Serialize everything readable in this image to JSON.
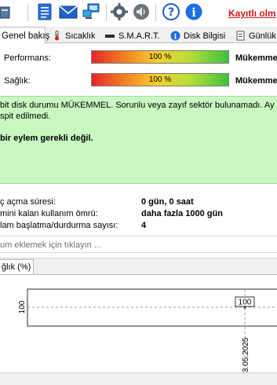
{
  "toolbar": {
    "icons": [
      "notepad-icon",
      "email-icon",
      "network-icon",
      "gear-icon",
      "speaker-icon",
      "help-icon",
      "info-icon"
    ],
    "link": "Kayıtlı olm"
  },
  "tabs": [
    {
      "label": "Genel bakış",
      "active": true
    },
    {
      "label": "Sıcaklık",
      "active": false
    },
    {
      "label": "S.M.A.R.T.",
      "active": false
    },
    {
      "label": "Disk Bilgisi",
      "active": false
    },
    {
      "label": "Günlük",
      "active": false
    }
  ],
  "health": {
    "performance": {
      "label": "Performans:",
      "value_text": "100 %",
      "value": 100,
      "status": "Mükemme"
    },
    "health": {
      "label": "Sağlık:",
      "value_text": "100 %",
      "value": 100,
      "status": "Mükemme"
    }
  },
  "message": {
    "line1": "bit disk durumu MÜKEMMEL. Sorunlu veya zayıf sektör bulunamadı. Ay",
    "line2": "spit edilmedi.",
    "line3": "bir eylem gerekli değil."
  },
  "info": {
    "rows": [
      {
        "label": "ç açma süresi:",
        "value": "0 gün, 0 saat"
      },
      {
        "label": "mini kalan kullanım ömrü:",
        "value": "daha fazla 1000 gün"
      },
      {
        "label": "lam başlatma/durdurma sayısı:",
        "value": "4"
      }
    ]
  },
  "note": {
    "placeholder": "um eklemek için tıklayın ..."
  },
  "chart_tab": {
    "label": "ğlık (%)"
  },
  "colors": {
    "link": "#d01818",
    "message_bg": "#c8f7c0",
    "good": "#3dc23d",
    "bad": "#e8242a"
  },
  "chart_data": {
    "type": "line",
    "title": "ğlık (%)",
    "x": [
      "3.05.2025"
    ],
    "series": [
      {
        "values": [
          100
        ]
      }
    ],
    "y_tick_labels": [
      "100"
    ],
    "x_tick_labels": [
      "3.05.2025"
    ],
    "data_labels": [
      "100"
    ],
    "grid": true
  }
}
